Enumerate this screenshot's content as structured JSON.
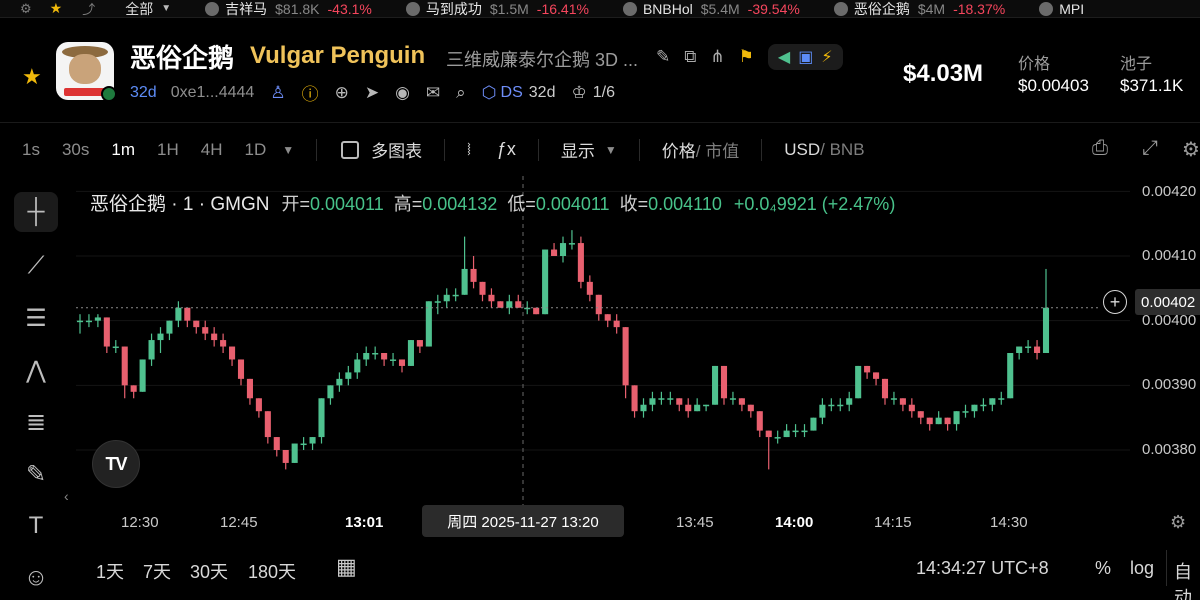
{
  "ticker": {
    "all_label": "全部",
    "items": [
      {
        "name": "吉祥马",
        "value": "$81.8K",
        "change": "-43.1%"
      },
      {
        "name": "马到成功",
        "value": "$1.5M",
        "change": "-16.41%"
      },
      {
        "name": "BNBHol",
        "value": "$5.4M",
        "change": "-39.54%"
      },
      {
        "name": "恶俗企鹅",
        "value": "$4M",
        "change": "-18.37%"
      },
      {
        "name": "MPI",
        "value": "",
        "change": ""
      }
    ]
  },
  "token": {
    "name_cn": "恶俗企鹅",
    "name_en": "Vulgar Penguin",
    "description": "三维威廉泰尔企鹅 3D ...",
    "age": "32d",
    "address": "0xe1...4444",
    "ds_label": "DS",
    "ds_age": "32d",
    "holders_ratio": "1/6"
  },
  "stats": {
    "market_cap": "$4.03M",
    "price_label": "价格",
    "price": "$0.00403",
    "pool_label": "池子",
    "pool": "$371.1K"
  },
  "toolbar": {
    "timeframes": [
      "1s",
      "30s",
      "1m",
      "1H",
      "4H",
      "1D"
    ],
    "active_timeframe": "1m",
    "multi_chart": "多图表",
    "display": "显示",
    "price_mode": "价格",
    "cap_mode": "/ 市值",
    "usd": "USD",
    "bnb": "/ BNB"
  },
  "legend": {
    "symbol": "恶俗企鹅 · 1 · GMGN",
    "open_label": "开=",
    "open": "0.004011",
    "high_label": "高=",
    "high": "0.004132",
    "low_label": "低=",
    "low": "0.004011",
    "close_label": "收=",
    "close": "0.004110",
    "change": "+0.0₄9921 (+2.47%)"
  },
  "axis": {
    "x_labels": [
      "12:30",
      "12:45",
      "13:01",
      "13:45",
      "14:00",
      "14:15",
      "14:30"
    ],
    "crosshair_label": "周四 2025-11-27  13:20",
    "y_labels": [
      "0.00420",
      "0.00410",
      "0.00400",
      "0.00390",
      "0.00380"
    ],
    "price_tag": "0.00402"
  },
  "chart_data": {
    "type": "candlestick",
    "x_label_times": [
      "12:30",
      "12:45",
      "13:01",
      "13:45",
      "14:00",
      "14:15",
      "14:30"
    ],
    "ylim": [
      0.00375,
      0.00422
    ],
    "last_price": 0.00402,
    "crosshair_time": "2025-11-27 13:20",
    "ohlc": [
      [
        0.004,
        0.00401,
        0.00398,
        0.004
      ],
      [
        0.004,
        0.00401,
        0.00399,
        0.004
      ],
      [
        0.004,
        0.00401,
        0.00399,
        0.004005
      ],
      [
        0.004005,
        0.004005,
        0.00395,
        0.00396
      ],
      [
        0.00396,
        0.00397,
        0.00395,
        0.00396
      ],
      [
        0.00396,
        0.00396,
        0.00388,
        0.0039
      ],
      [
        0.0039,
        0.0039,
        0.00388,
        0.00389
      ],
      [
        0.00389,
        0.00394,
        0.00389,
        0.00394
      ],
      [
        0.00394,
        0.00398,
        0.00393,
        0.00397
      ],
      [
        0.00397,
        0.00399,
        0.00395,
        0.00398
      ],
      [
        0.00398,
        0.004,
        0.00397,
        0.004
      ],
      [
        0.004,
        0.00403,
        0.00399,
        0.00402
      ],
      [
        0.00402,
        0.00402,
        0.00399,
        0.004
      ],
      [
        0.004,
        0.004,
        0.00398,
        0.00399
      ],
      [
        0.00399,
        0.004,
        0.00397,
        0.00398
      ],
      [
        0.00398,
        0.00399,
        0.00396,
        0.00397
      ],
      [
        0.00397,
        0.00398,
        0.00395,
        0.00396
      ],
      [
        0.00396,
        0.00396,
        0.00393,
        0.00394
      ],
      [
        0.00394,
        0.00394,
        0.0039,
        0.00391
      ],
      [
        0.00391,
        0.00391,
        0.00387,
        0.00388
      ],
      [
        0.00388,
        0.00388,
        0.00385,
        0.00386
      ],
      [
        0.00386,
        0.00386,
        0.00381,
        0.00382
      ],
      [
        0.00382,
        0.00382,
        0.00379,
        0.0038
      ],
      [
        0.0038,
        0.0038,
        0.00377,
        0.00378
      ],
      [
        0.00378,
        0.00381,
        0.00378,
        0.00381
      ],
      [
        0.00381,
        0.00382,
        0.0038,
        0.00381
      ],
      [
        0.00381,
        0.00382,
        0.0038,
        0.00382
      ],
      [
        0.00382,
        0.00388,
        0.00381,
        0.00388
      ],
      [
        0.00388,
        0.0039,
        0.00387,
        0.0039
      ],
      [
        0.0039,
        0.00392,
        0.00389,
        0.00391
      ],
      [
        0.00391,
        0.00393,
        0.0039,
        0.00392
      ],
      [
        0.00392,
        0.00395,
        0.00391,
        0.00394
      ],
      [
        0.00394,
        0.00396,
        0.00393,
        0.00395
      ],
      [
        0.00395,
        0.00396,
        0.00394,
        0.00395
      ],
      [
        0.00395,
        0.00395,
        0.00393,
        0.00394
      ],
      [
        0.00394,
        0.00395,
        0.00393,
        0.00394
      ],
      [
        0.00394,
        0.00394,
        0.00392,
        0.00393
      ],
      [
        0.00393,
        0.00397,
        0.00393,
        0.00397
      ],
      [
        0.00397,
        0.00397,
        0.00395,
        0.00396
      ],
      [
        0.00396,
        0.00403,
        0.00396,
        0.00403
      ],
      [
        0.00403,
        0.00404,
        0.00401,
        0.00403
      ],
      [
        0.00403,
        0.00405,
        0.00402,
        0.00404
      ],
      [
        0.00404,
        0.00405,
        0.00403,
        0.00404
      ],
      [
        0.00404,
        0.00413,
        0.00404,
        0.00408
      ],
      [
        0.00408,
        0.0041,
        0.00405,
        0.00406
      ],
      [
        0.00406,
        0.00406,
        0.00403,
        0.00404
      ],
      [
        0.00404,
        0.00405,
        0.00402,
        0.00403
      ],
      [
        0.00403,
        0.00403,
        0.00402,
        0.00402
      ],
      [
        0.00402,
        0.00404,
        0.00401,
        0.00403
      ],
      [
        0.00403,
        0.00404,
        0.00402,
        0.00402
      ],
      [
        0.00402,
        0.00403,
        0.00401,
        0.00402
      ],
      [
        0.00402,
        0.00402,
        0.00401,
        0.00401
      ],
      [
        0.00401,
        0.00411,
        0.00401,
        0.00411
      ],
      [
        0.00411,
        0.00412,
        0.0041,
        0.0041
      ],
      [
        0.0041,
        0.00413,
        0.00409,
        0.00412
      ],
      [
        0.00412,
        0.00414,
        0.00411,
        0.00412
      ],
      [
        0.00412,
        0.00413,
        0.00405,
        0.00406
      ],
      [
        0.00406,
        0.00407,
        0.00403,
        0.00404
      ],
      [
        0.00404,
        0.00404,
        0.004,
        0.00401
      ],
      [
        0.00401,
        0.00401,
        0.00399,
        0.004
      ],
      [
        0.004,
        0.00401,
        0.00398,
        0.00399
      ],
      [
        0.00399,
        0.00399,
        0.00388,
        0.0039
      ],
      [
        0.0039,
        0.0039,
        0.00385,
        0.00386
      ],
      [
        0.00386,
        0.00388,
        0.00385,
        0.00387
      ],
      [
        0.00387,
        0.00389,
        0.00386,
        0.00388
      ],
      [
        0.00388,
        0.00389,
        0.00387,
        0.00388
      ],
      [
        0.00388,
        0.00389,
        0.00387,
        0.00388
      ],
      [
        0.00388,
        0.00388,
        0.00386,
        0.00387
      ],
      [
        0.00387,
        0.00388,
        0.00385,
        0.00386
      ],
      [
        0.00386,
        0.00388,
        0.00386,
        0.00387
      ],
      [
        0.00387,
        0.00387,
        0.00386,
        0.00387
      ],
      [
        0.00387,
        0.00393,
        0.00387,
        0.00393
      ],
      [
        0.00393,
        0.00393,
        0.00387,
        0.00388
      ],
      [
        0.00388,
        0.00389,
        0.00387,
        0.00388
      ],
      [
        0.00388,
        0.00388,
        0.00386,
        0.00387
      ],
      [
        0.00387,
        0.00387,
        0.00385,
        0.00386
      ],
      [
        0.00386,
        0.00386,
        0.00382,
        0.00383
      ],
      [
        0.00383,
        0.00383,
        0.00377,
        0.00382
      ],
      [
        0.00382,
        0.00383,
        0.00381,
        0.00382
      ],
      [
        0.00382,
        0.00384,
        0.00382,
        0.00383
      ],
      [
        0.00383,
        0.00384,
        0.00382,
        0.00383
      ],
      [
        0.00383,
        0.00384,
        0.00382,
        0.00383
      ],
      [
        0.00383,
        0.00385,
        0.00383,
        0.00385
      ],
      [
        0.00385,
        0.00388,
        0.00384,
        0.00387
      ],
      [
        0.00387,
        0.00388,
        0.00386,
        0.00387
      ],
      [
        0.00387,
        0.00388,
        0.00386,
        0.00387
      ],
      [
        0.00387,
        0.00389,
        0.00386,
        0.00388
      ],
      [
        0.00388,
        0.00393,
        0.00388,
        0.00393
      ],
      [
        0.00393,
        0.00393,
        0.00391,
        0.00392
      ],
      [
        0.00392,
        0.00392,
        0.0039,
        0.00391
      ],
      [
        0.00391,
        0.00391,
        0.00387,
        0.00388
      ],
      [
        0.00388,
        0.00389,
        0.00387,
        0.00388
      ],
      [
        0.00388,
        0.00388,
        0.00386,
        0.00387
      ],
      [
        0.00387,
        0.00388,
        0.00385,
        0.00386
      ],
      [
        0.00386,
        0.00386,
        0.00384,
        0.00385
      ],
      [
        0.00385,
        0.00385,
        0.00383,
        0.00384
      ],
      [
        0.00384,
        0.00386,
        0.00384,
        0.00385
      ],
      [
        0.00385,
        0.00385,
        0.00383,
        0.00384
      ],
      [
        0.00384,
        0.00386,
        0.00383,
        0.00386
      ],
      [
        0.00386,
        0.00387,
        0.00385,
        0.00386
      ],
      [
        0.00386,
        0.00387,
        0.00385,
        0.00387
      ],
      [
        0.00387,
        0.00388,
        0.00386,
        0.00387
      ],
      [
        0.00387,
        0.00388,
        0.00386,
        0.00388
      ],
      [
        0.00388,
        0.00389,
        0.00387,
        0.00388
      ],
      [
        0.00388,
        0.00395,
        0.00388,
        0.00395
      ],
      [
        0.00395,
        0.00396,
        0.00394,
        0.00396
      ],
      [
        0.00396,
        0.00397,
        0.00395,
        0.00396
      ],
      [
        0.00396,
        0.00397,
        0.00394,
        0.00395
      ],
      [
        0.00395,
        0.00408,
        0.00395,
        0.00402
      ]
    ]
  },
  "bottom": {
    "ranges": [
      "1天",
      "7天",
      "30天",
      "180天"
    ],
    "clock": "14:34:27 UTC+8",
    "percent": "%",
    "log": "log",
    "auto": "自动"
  },
  "colors": {
    "up": "#4fc18f",
    "down": "#e8606f",
    "accent": "#f0b90b",
    "link": "#5d8cf6"
  }
}
